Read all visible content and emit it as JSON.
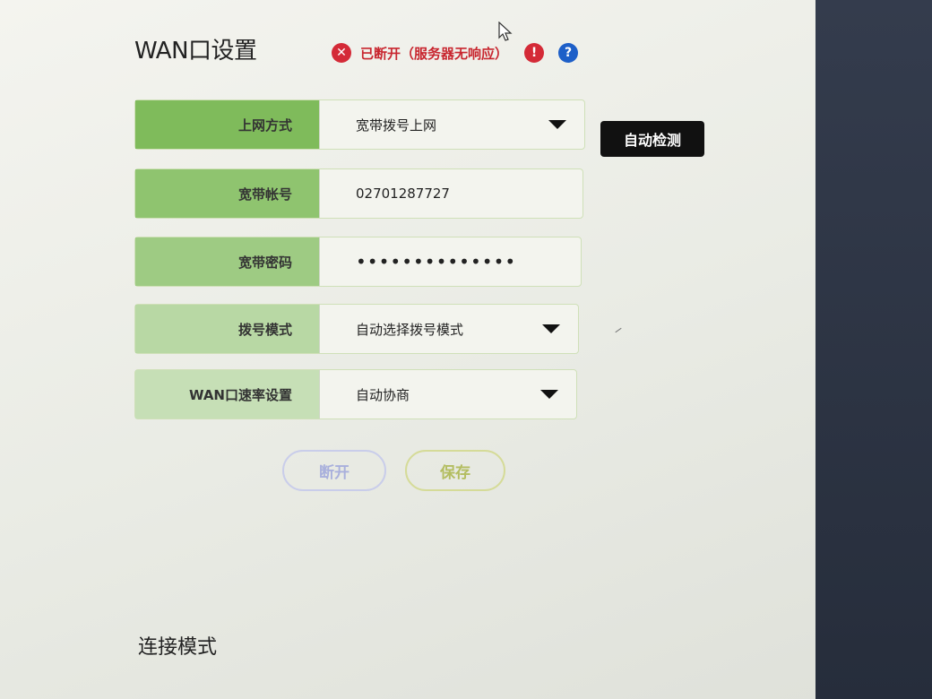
{
  "page": {
    "title": "WAN口设置",
    "section_title": "连接模式"
  },
  "status": {
    "text": "已断开（服务器无响应）",
    "state_color": "#d42a37",
    "icons": [
      "close-circle-icon",
      "exclamation-icon",
      "help-icon"
    ]
  },
  "form": {
    "rows": [
      {
        "label": "上网方式",
        "value": "宽带拨号上网",
        "type": "select"
      },
      {
        "label": "宽带帐号",
        "value": "02701287727",
        "type": "text"
      },
      {
        "label": "宽带密码",
        "value": "••••••••••••••",
        "type": "password"
      },
      {
        "label": "拨号模式",
        "value": "自动选择拨号模式",
        "type": "select"
      },
      {
        "label": "WAN口速率设置",
        "value": "自动协商",
        "type": "select"
      }
    ]
  },
  "buttons": {
    "auto_detect": "自动检测",
    "disconnect": "断开",
    "save": "保存"
  },
  "colors": {
    "label_green": "#7fbb5b",
    "accent_dark": "#111111",
    "help_blue": "#1d5fc8"
  }
}
